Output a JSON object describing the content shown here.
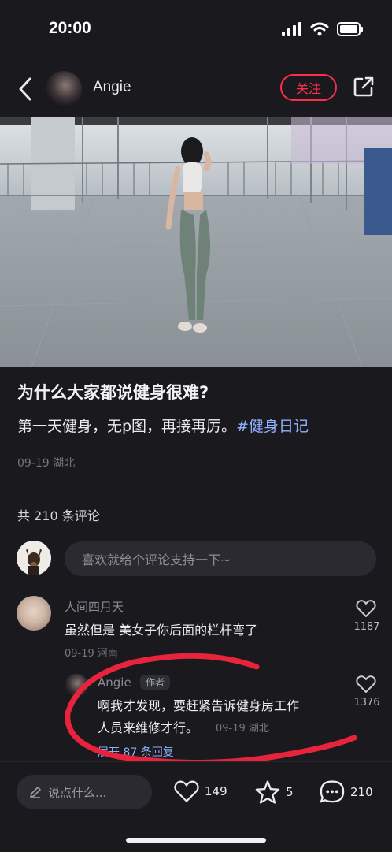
{
  "status": {
    "time": "20:00"
  },
  "nav": {
    "author": "Angie",
    "follow": "关注"
  },
  "post": {
    "title": "为什么大家都说健身很难?",
    "body": "第一天健身，无p图，再接再厉。",
    "hashtag": "#健身日记",
    "meta": "09-19 湖北"
  },
  "comments": {
    "count_label": "共 210 条评论",
    "input_placeholder": "喜欢就给个评论支持一下~",
    "items": [
      {
        "name": "人间四月天",
        "text": "虽然但是 美女子你后面的栏杆弯了",
        "meta": "09-19 河南",
        "likes": "1187",
        "reply": {
          "name": "Angie",
          "tag": "作者",
          "text_line1": "啊我才发现，要赶紧告诉健身房工作",
          "text_line2": "人员来维修才行。",
          "meta": "09-19 湖北",
          "likes": "1376"
        },
        "expand": "展开 87 条回复"
      }
    ]
  },
  "bottom": {
    "input_placeholder": "说点什么...",
    "likes": "149",
    "collects": "5",
    "comments": "210"
  },
  "colors": {
    "accent_red": "#ff2e4d",
    "link_blue": "#8fb1ff",
    "background": "#1a191e"
  }
}
